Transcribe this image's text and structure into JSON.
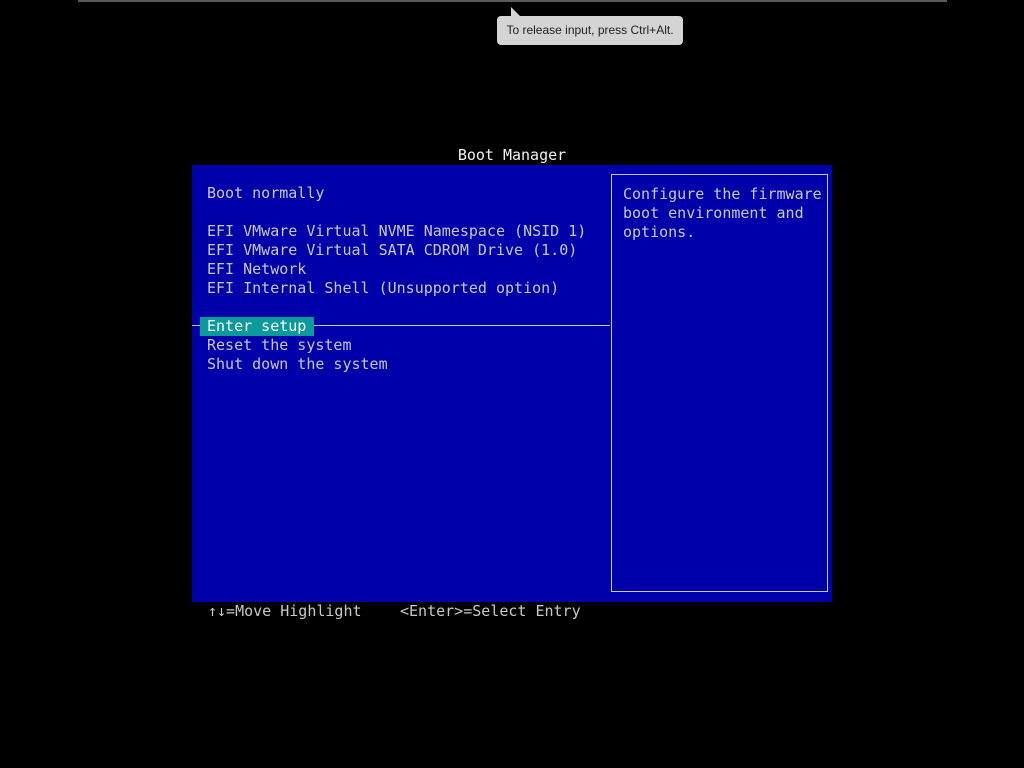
{
  "tooltip": {
    "text": "To release input, press Ctrl+Alt."
  },
  "boot_manager": {
    "title": "Boot Manager",
    "menu": {
      "items": [
        {
          "label": "Boot normally"
        },
        {
          "label": "EFI VMware Virtual NVME Namespace (NSID 1)"
        },
        {
          "label": "EFI VMware Virtual SATA CDROM Drive (1.0)"
        },
        {
          "label": "EFI Network"
        },
        {
          "label": "EFI Internal Shell (Unsupported option)"
        },
        {
          "label": "Enter setup",
          "selected": true
        },
        {
          "label": "Reset the system"
        },
        {
          "label": "Shut down the system"
        }
      ]
    },
    "help": {
      "lines": [
        "Configure the firmware",
        "boot environment and",
        "options."
      ]
    }
  },
  "footer": {
    "move_hint": "↑↓=Move Highlight",
    "select_hint": "<Enter>=Select Entry"
  },
  "colors": {
    "background": "#000000",
    "panel": "#0000aa",
    "highlight": "#0a9a9a",
    "text": "#c8c8c8",
    "title_text": "#f2f2f2"
  }
}
